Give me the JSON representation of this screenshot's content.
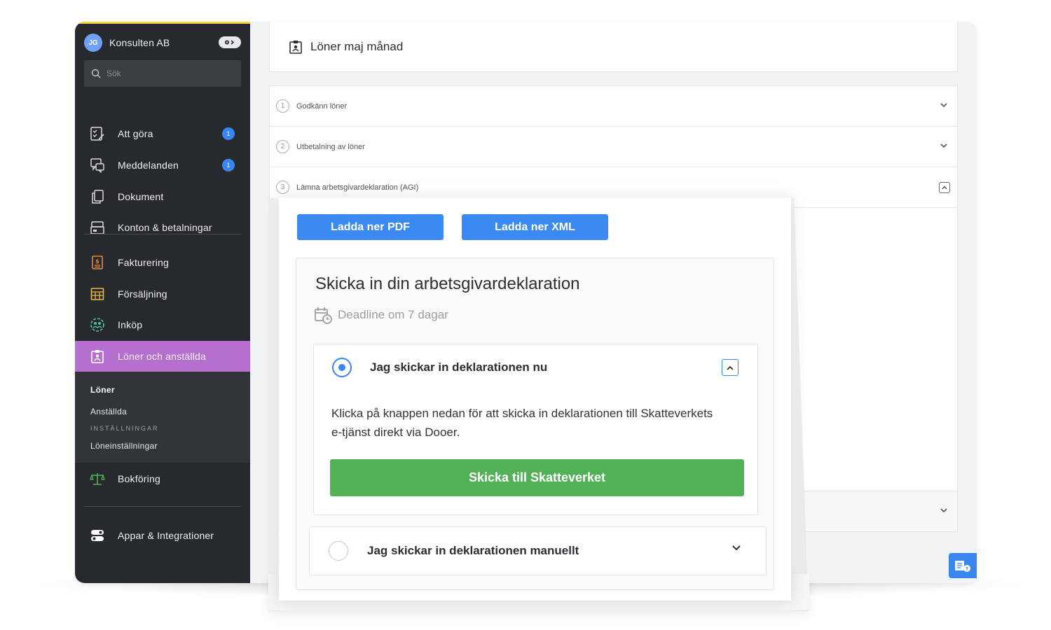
{
  "sidebar": {
    "avatar_initials": "JG",
    "company_name": "Konsulten AB",
    "search_placeholder": "Sök",
    "primary_items": [
      {
        "label": "Att göra",
        "badge": "1",
        "icon": "checklist-icon"
      },
      {
        "label": "Meddelanden",
        "badge": "1",
        "icon": "messages-icon"
      },
      {
        "label": "Dokument",
        "icon": "documents-icon"
      },
      {
        "label": "Konton & betalningar",
        "icon": "card-icon"
      }
    ],
    "secondary_items": [
      {
        "label": "Fakturering",
        "icon": "invoice-icon",
        "color": "#e98a3b"
      },
      {
        "label": "Försäljning",
        "icon": "sales-icon",
        "color": "#f0b93a"
      },
      {
        "label": "Inköp",
        "icon": "purchase-icon",
        "color": "#4ec69a"
      },
      {
        "label": "Löner och anställda",
        "icon": "payroll-icon",
        "active": true
      }
    ],
    "sub_items": {
      "loner": "Löner",
      "anstallda": "Anställda",
      "settings_header": "INSTÄLLNINGAR",
      "loneinstallningar": "Löneinställningar"
    },
    "bookkeeping": {
      "label": "Bokföring",
      "icon": "scales-icon",
      "color": "#52b157"
    },
    "apps": {
      "label": "Appar & Integrationer",
      "icon": "toggles-icon"
    },
    "active_color": "#b56fce"
  },
  "main": {
    "page_title": "Löner maj månad",
    "steps": [
      {
        "num": "1",
        "label": "Godkänn löner"
      },
      {
        "num": "2",
        "label": "Utbetalning av löner"
      },
      {
        "num": "3",
        "label": "Lämna arbetsgivardeklaration (AGI)"
      }
    ]
  },
  "panel": {
    "download_pdf": "Ladda ner PDF",
    "download_xml": "Ladda ner XML",
    "title": "Skicka in din arbetsgivardeklaration",
    "deadline": "Deadline om 7 dagar",
    "option_now": {
      "label": "Jag skickar in deklarationen nu",
      "description": "Klicka på knappen nedan för att skicka in deklarationen till Skatteverkets e-tjänst direkt via Dooer.",
      "button": "Skicka till Skatteverket"
    },
    "option_manual": {
      "label": "Jag skickar in deklarationen manuellt"
    }
  },
  "colors": {
    "primary_blue": "#3b8af2",
    "success_green": "#52b157",
    "sidebar_bg": "#26292d"
  }
}
